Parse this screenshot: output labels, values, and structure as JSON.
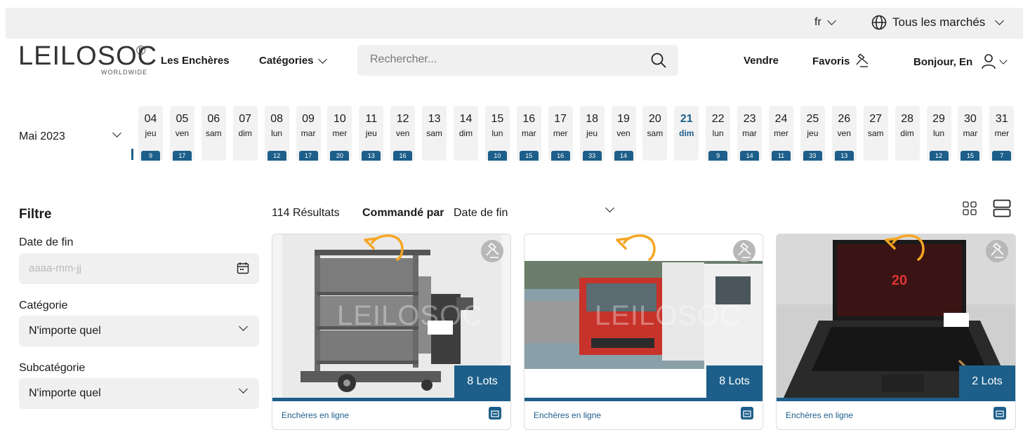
{
  "topbar": {
    "language": "fr",
    "markets": "Tous les marchés"
  },
  "header": {
    "logo_main": "LEILOSOC",
    "logo_reg": "®",
    "logo_sub": "WORLDWIDE",
    "nav": {
      "auctions": "Les Enchères",
      "categories": "Catégories"
    },
    "search_placeholder": "Rechercher...",
    "sell": "Vendre",
    "favorites": "Favoris",
    "greeting": "Bonjour, En"
  },
  "calendar": {
    "month": "Mai 2023",
    "days": [
      {
        "num": "04",
        "name": "jeu",
        "count": "9"
      },
      {
        "num": "05",
        "name": "ven",
        "count": "17"
      },
      {
        "num": "06",
        "name": "sam",
        "count": ""
      },
      {
        "num": "07",
        "name": "dim",
        "count": ""
      },
      {
        "num": "08",
        "name": "lun",
        "count": "12"
      },
      {
        "num": "09",
        "name": "mar",
        "count": "17"
      },
      {
        "num": "10",
        "name": "mer",
        "count": "20"
      },
      {
        "num": "11",
        "name": "jeu",
        "count": "13"
      },
      {
        "num": "12",
        "name": "ven",
        "count": "16"
      },
      {
        "num": "13",
        "name": "sam",
        "count": ""
      },
      {
        "num": "14",
        "name": "dim",
        "count": ""
      },
      {
        "num": "15",
        "name": "lun",
        "count": "10"
      },
      {
        "num": "16",
        "name": "mar",
        "count": "15"
      },
      {
        "num": "17",
        "name": "mer",
        "count": "16"
      },
      {
        "num": "18",
        "name": "jeu",
        "count": "33"
      },
      {
        "num": "19",
        "name": "ven",
        "count": "14"
      },
      {
        "num": "20",
        "name": "sam",
        "count": ""
      },
      {
        "num": "21",
        "name": "dim",
        "count": "",
        "active": true
      },
      {
        "num": "22",
        "name": "lun",
        "count": "9"
      },
      {
        "num": "23",
        "name": "mar",
        "count": "14"
      },
      {
        "num": "24",
        "name": "mer",
        "count": "11"
      },
      {
        "num": "25",
        "name": "jeu",
        "count": "33"
      },
      {
        "num": "26",
        "name": "ven",
        "count": "13"
      },
      {
        "num": "27",
        "name": "sam",
        "count": ""
      },
      {
        "num": "28",
        "name": "dim",
        "count": ""
      },
      {
        "num": "29",
        "name": "lun",
        "count": "12"
      },
      {
        "num": "30",
        "name": "mar",
        "count": "15"
      },
      {
        "num": "31",
        "name": "mer",
        "count": "7"
      }
    ]
  },
  "filters": {
    "title": "Filtre",
    "end_date_label": "Date de fin",
    "end_date_placeholder": "aaaa-mm-jj",
    "category_label": "Catégorie",
    "category_value": "N'importe quel",
    "subcategory_label": "Subcatégorie",
    "subcategory_value": "N'importe quel"
  },
  "results": {
    "count": "114 Résultats",
    "order_label": "Commandé par",
    "order_value": "Date de fin"
  },
  "cards": [
    {
      "lots": "8 Lots",
      "type": "Enchères en ligne",
      "watermark": "LEILOSOC"
    },
    {
      "lots": "8 Lots",
      "type": "Enchères en ligne",
      "watermark": "LEILOSOC"
    },
    {
      "lots": "2 Lots",
      "type": "Enchères en ligne",
      "watermark": ""
    }
  ],
  "colors": {
    "accent": "#1d5f8a",
    "rotate_arrow": "#f5a623",
    "field_bg": "#f0f0f0"
  }
}
